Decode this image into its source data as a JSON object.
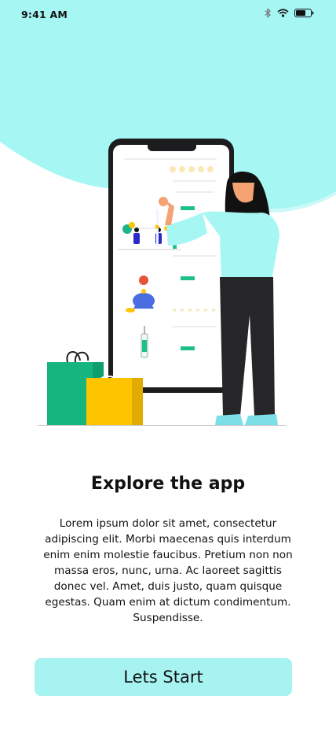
{
  "status_bar": {
    "time": "9:41 AM",
    "icons": [
      "bluetooth-icon",
      "wifi-icon",
      "battery-icon"
    ]
  },
  "onboarding": {
    "title": "Explore the app",
    "description": "Lorem ipsum dolor sit amet, consectetur adipiscing elit. Morbi maecenas quis interdum enim enim molestie faucibus. Pretium non non massa eros, nunc, urna. Ac laoreet sagittis donec vel. Amet, duis justo, quam quisque egestas. Quam enim at dictum condimentum. Suspendisse.",
    "cta_label": "Lets Start"
  },
  "colors": {
    "accent": "#a7f3f2",
    "blob": "#a6f6f4",
    "green": "#1dbf8a",
    "bag_green": "#16b57f",
    "bag_yellow": "#ffc400",
    "dark": "#1d1d1f"
  }
}
